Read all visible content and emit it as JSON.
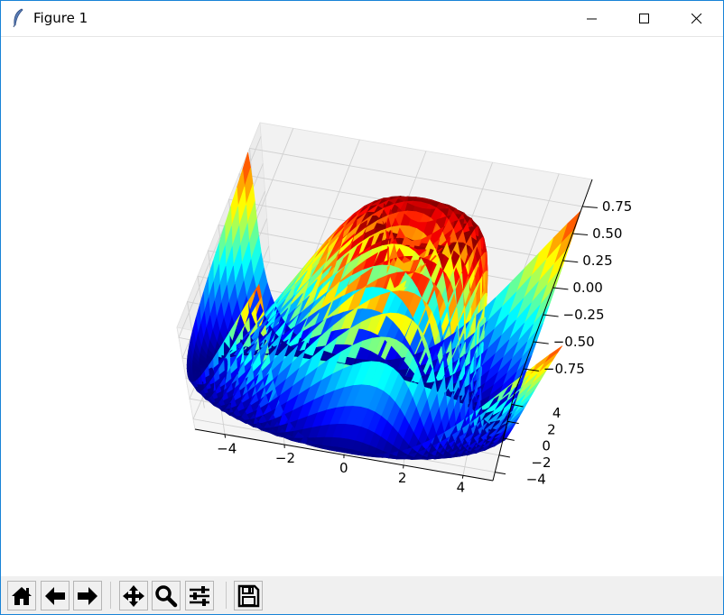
{
  "window": {
    "title": "Figure 1",
    "controls": [
      "minimize",
      "maximize",
      "close"
    ]
  },
  "toolbar": {
    "buttons": [
      {
        "name": "home",
        "icon": "home-icon"
      },
      {
        "name": "back",
        "icon": "arrow-left-icon"
      },
      {
        "name": "forward",
        "icon": "arrow-right-icon"
      },
      {
        "name": "pan",
        "icon": "move-icon"
      },
      {
        "name": "zoom",
        "icon": "magnifier-icon"
      },
      {
        "name": "configure-subplots",
        "icon": "sliders-icon"
      },
      {
        "name": "save",
        "icon": "floppy-icon"
      }
    ]
  },
  "chart_data": {
    "type": "surface",
    "function": "z = sin(sqrt(x^2 + y^2))",
    "colormap": "jet",
    "x_range": [
      -5,
      5
    ],
    "y_range": [
      -5,
      5
    ],
    "z_range": [
      -1,
      1
    ],
    "grid_step": 0.25,
    "xticks": [
      "−4",
      "−2",
      "0",
      "2",
      "4"
    ],
    "yticks": [
      "−4",
      "−2",
      "0",
      "2",
      "4"
    ],
    "zticks": [
      "0.75",
      "0.50",
      "0.25",
      "0.00",
      "−0.25",
      "−0.50",
      "−0.75"
    ],
    "view": {
      "elevation": 50,
      "azimuth": -80
    },
    "grid": true,
    "title": "",
    "xlabel": "",
    "ylabel": "",
    "zlabel": ""
  }
}
